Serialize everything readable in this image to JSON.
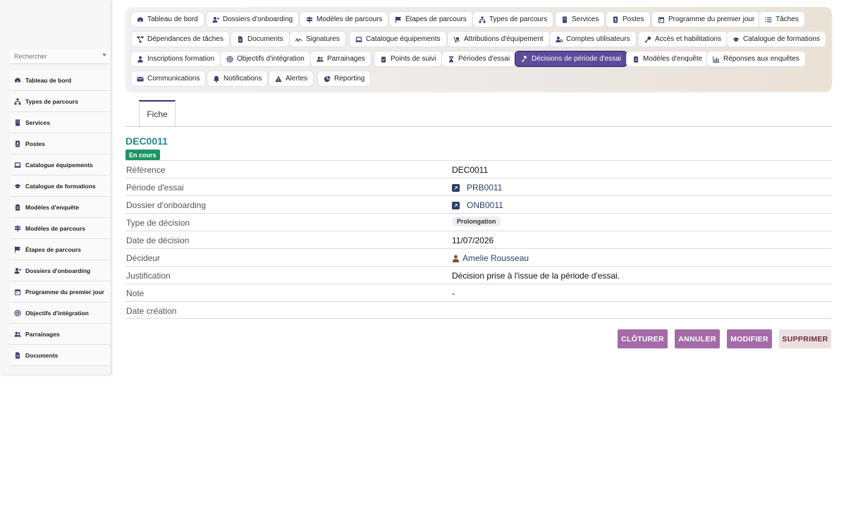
{
  "sidebar": {
    "search_placeholder": "Rechercher",
    "items": [
      {
        "label": "Tableau de bord",
        "icon": "dashboard-icon"
      },
      {
        "label": "Types de parcours",
        "icon": "sitemap-icon"
      },
      {
        "label": "Services",
        "icon": "building-icon"
      },
      {
        "label": "Postes",
        "icon": "id-card-icon"
      },
      {
        "label": "Catalogue équipements",
        "icon": "laptop-icon"
      },
      {
        "label": "Catalogue de formations",
        "icon": "graduation-cap-icon"
      },
      {
        "label": "Modèles d'enquête",
        "icon": "clipboard-icon"
      },
      {
        "label": "Modèles de parcours",
        "icon": "signpost-icon"
      },
      {
        "label": "Étapes de parcours",
        "icon": "flag-icon"
      },
      {
        "label": "Dossiers d'onboarding",
        "icon": "user-plus-icon"
      },
      {
        "label": "Programme du premier jour",
        "icon": "calendar-icon"
      },
      {
        "label": "Objectifs d'intégration",
        "icon": "target-icon"
      },
      {
        "label": "Parrainages",
        "icon": "users-icon"
      },
      {
        "label": "Documents",
        "icon": "file-icon"
      }
    ]
  },
  "tabs": [
    {
      "label": "Tableau de bord",
      "icon": "dashboard-icon"
    },
    {
      "label": "Dossiers d'onboarding",
      "icon": "user-plus-icon"
    },
    {
      "label": "Modèles de parcours",
      "icon": "signpost-icon"
    },
    {
      "label": "Étapes de parcours",
      "icon": "flag-icon"
    },
    {
      "label": "Types de parcours",
      "icon": "sitemap-icon"
    },
    {
      "label": "Services",
      "icon": "building-icon"
    },
    {
      "label": "Postes",
      "icon": "id-card-icon"
    },
    {
      "label": "Programme du premier jour",
      "icon": "calendar-icon"
    },
    {
      "label": "Tâches",
      "icon": "list-icon"
    },
    {
      "label": "Dépendances de tâches",
      "icon": "project-diagram-icon"
    },
    {
      "label": "Documents",
      "icon": "file-icon"
    },
    {
      "label": "Signatures",
      "icon": "signature-icon"
    },
    {
      "label": "Catalogue équipements",
      "icon": "laptop-icon"
    },
    {
      "label": "Attributions d'équipement",
      "icon": "dolly-icon"
    },
    {
      "label": "Comptes utilisateurs",
      "icon": "user-cog-icon"
    },
    {
      "label": "Accès et habilitations",
      "icon": "key-icon"
    },
    {
      "label": "Catalogue de formations",
      "icon": "graduation-cap-icon"
    },
    {
      "label": "Inscriptions formation",
      "icon": "user-tie-icon"
    },
    {
      "label": "Objectifs d'intégration",
      "icon": "target-icon"
    },
    {
      "label": "Parrainages",
      "icon": "users-icon"
    },
    {
      "label": "Points de suivi",
      "icon": "clipboard-check-icon"
    },
    {
      "label": "Périodes d'essai",
      "icon": "hourglass-icon"
    },
    {
      "label": "Décisions de période d'essai",
      "icon": "gavel-icon",
      "active": true
    },
    {
      "label": "Modèles d'enquête",
      "icon": "clipboard-icon"
    },
    {
      "label": "Réponses aux enquêtes",
      "icon": "chart-icon"
    },
    {
      "label": "Communications",
      "icon": "envelope-icon"
    },
    {
      "label": "Notifications",
      "icon": "bell-icon"
    },
    {
      "label": "Alertes",
      "icon": "warning-icon"
    },
    {
      "label": "Reporting",
      "icon": "pie-chart-icon"
    }
  ],
  "subtab": {
    "label": "Fiche"
  },
  "record": {
    "title": "DEC0011",
    "status": "En cours",
    "fields": {
      "reference": {
        "label": "Référence",
        "value": "DEC0011"
      },
      "periode": {
        "label": "Période d'essai",
        "value": "PRB0011"
      },
      "dossier": {
        "label": "Dossier d'onboarding",
        "value": "ONB0011"
      },
      "type": {
        "label": "Type de décision",
        "value": "Prolongation"
      },
      "date": {
        "label": "Date de décision",
        "value": "11/07/2026"
      },
      "decideur": {
        "label": "Décideur",
        "value": "Amelie Rousseau"
      },
      "justification": {
        "label": "Justification",
        "value": "Décision prise à l'issue de la période d'essai."
      },
      "note": {
        "label": "Note",
        "value": "-"
      },
      "creation": {
        "label": "Date création",
        "value": ""
      }
    }
  },
  "actions": {
    "close": "CLÔTURER",
    "cancel": "ANNULER",
    "edit": "MODIFIER",
    "delete": "SUPPRIMER"
  },
  "colors": {
    "accent": "#5b4b9a",
    "title": "#1f8a8a",
    "status": "#1d9463",
    "action": "#a46ba8"
  }
}
